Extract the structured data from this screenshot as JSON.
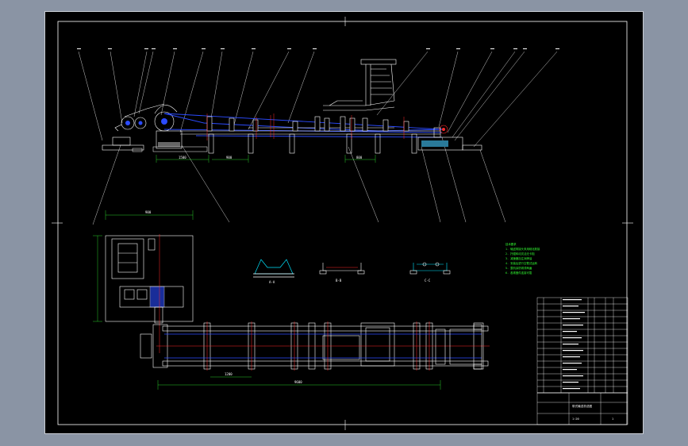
{
  "drawing": {
    "colors": {
      "background": "#000000",
      "frame": "#ffffff",
      "structure": "#ffffff",
      "belt": "#2b4bff",
      "dimension": "#33ff33",
      "centerline": "#ff2b2b",
      "detail": "#00e5ff"
    },
    "section_labels": {
      "a": "A-A",
      "b": "B-B",
      "c": "C-C"
    },
    "dimensions": {
      "drive_width": "1500",
      "head_span": "900",
      "mid_span": "800",
      "plan_width": "900",
      "plan_length": "9600",
      "gear_span": "1200"
    },
    "notes": [
      "技术要求",
      "1. 输送带接头采用硫化胶接",
      "2. 托辊转动灵活无卡阻",
      "3. 减速器加注润滑油",
      "4. 安装后进行空载试运转",
      "5. 整机涂防锈漆两遍",
      "6. 各紧固件连接可靠"
    ],
    "title_block": {
      "drawing_title": "带式输送机总图",
      "scale": "1:20",
      "sheet": "1"
    }
  }
}
